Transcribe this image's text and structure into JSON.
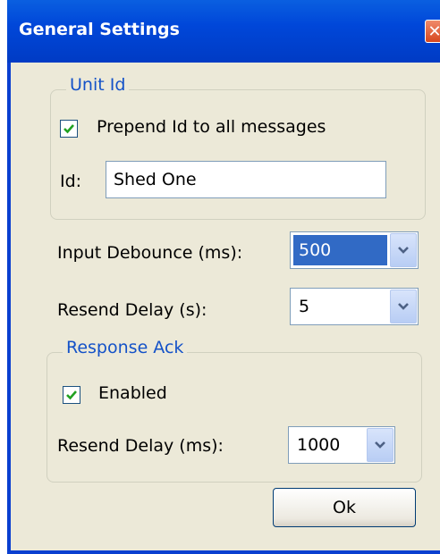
{
  "window": {
    "title": "General Settings",
    "close_glyph": "✕"
  },
  "unit_id": {
    "group_label": "Unit Id",
    "prepend_label": "Prepend Id to all messages",
    "prepend_checked": true,
    "id_label": "Id:",
    "id_value": "Shed One"
  },
  "input_debounce": {
    "label": "Input Debounce (ms):",
    "value": "500"
  },
  "resend_delay": {
    "label": "Resend Delay (s):",
    "value": "5"
  },
  "response_ack": {
    "group_label": "Response Ack",
    "enabled_label": "Enabled",
    "enabled_checked": true,
    "resend_label": "Resend Delay (ms):",
    "resend_value": "1000"
  },
  "ok_button": {
    "label": "Ok"
  },
  "colors": {
    "title_bar": "#0047d9",
    "dialog_bg": "#ece9d8",
    "group_label": "#1452c8",
    "selection": "#316ac5",
    "close_button": "#d6471e",
    "checkmark": "#21a121"
  }
}
